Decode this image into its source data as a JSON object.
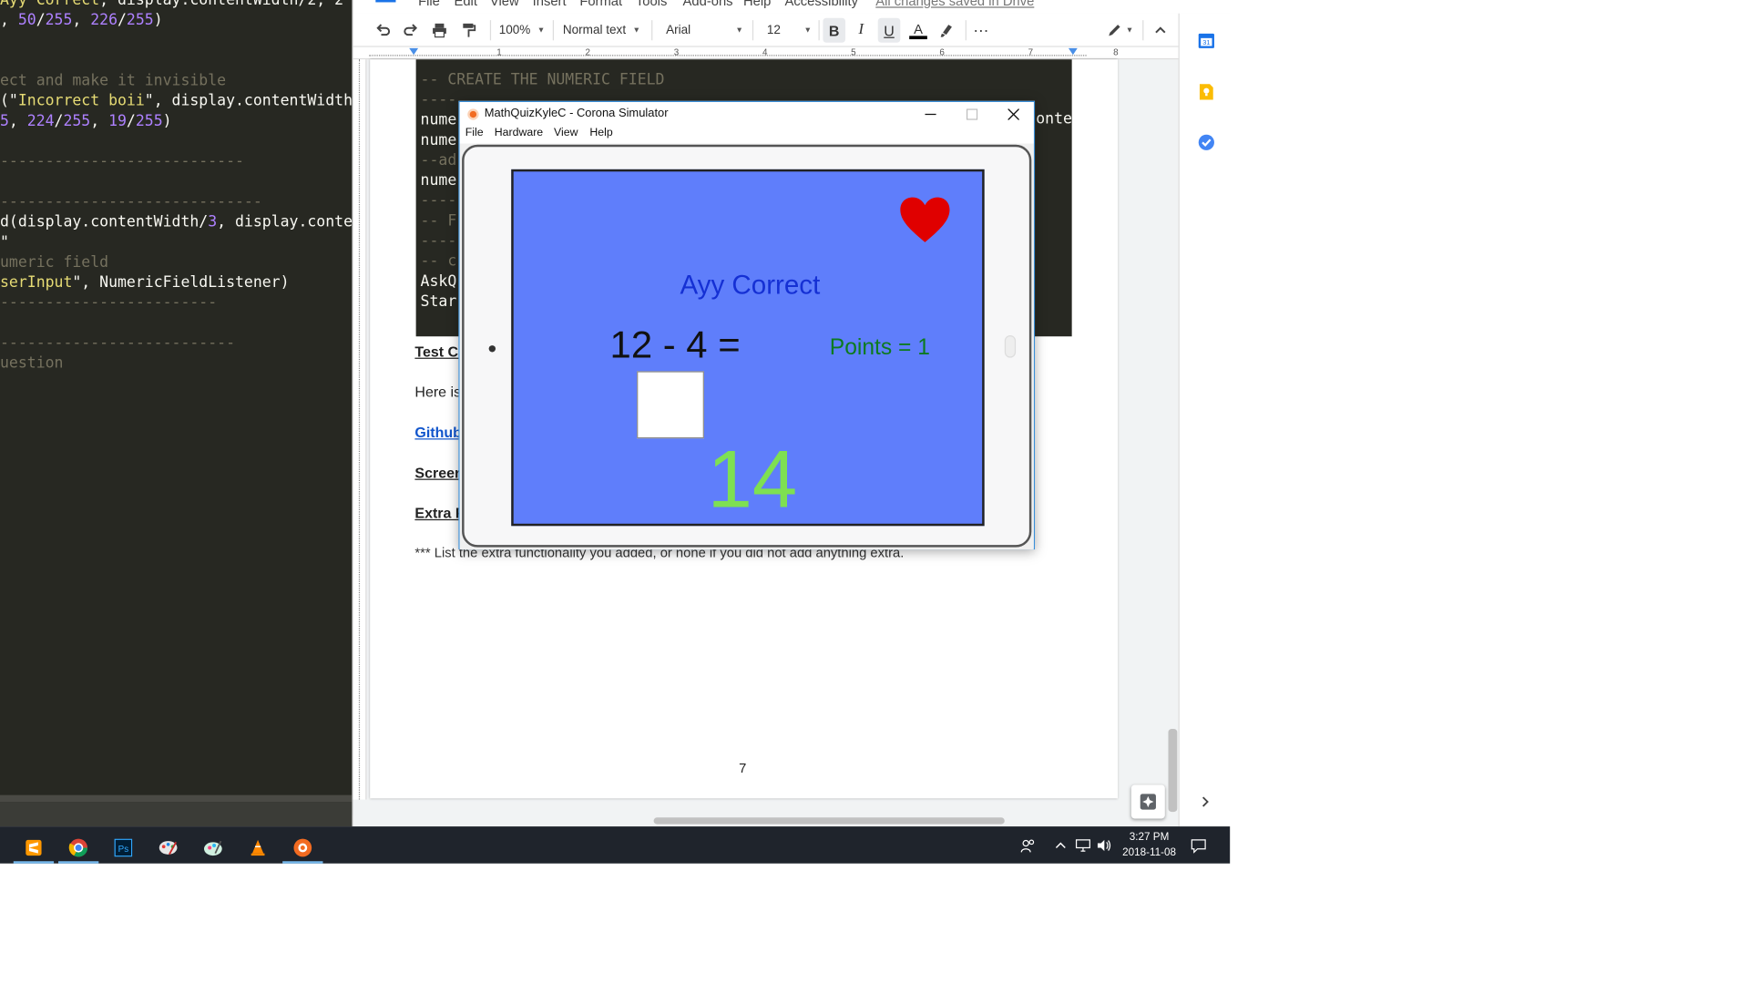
{
  "editor": {
    "lines": [
      [
        {
          "t": "Ayy Correct",
          "c": "str"
        },
        {
          "t": ", display.contentWidth/2, 2"
        }
      ],
      [
        {
          "t": ", "
        },
        {
          "t": "50",
          "c": "num"
        },
        {
          "t": "/"
        },
        {
          "t": "255",
          "c": "num"
        },
        {
          "t": ", "
        },
        {
          "t": "226",
          "c": "num"
        },
        {
          "t": "/"
        },
        {
          "t": "255",
          "c": "num"
        },
        {
          "t": ")"
        }
      ],
      [
        {
          "t": ""
        }
      ],
      [
        {
          "t": ""
        }
      ],
      [
        {
          "t": "ect and make it invisible",
          "c": "com"
        }
      ],
      [
        {
          "t": "(\""
        },
        {
          "t": "Incorrect boii",
          "c": "str"
        },
        {
          "t": "\", display.contentWidth"
        }
      ],
      [
        {
          "t": "5",
          "c": "num"
        },
        {
          "t": ", "
        },
        {
          "t": "224",
          "c": "num"
        },
        {
          "t": "/"
        },
        {
          "t": "255",
          "c": "num"
        },
        {
          "t": ", "
        },
        {
          "t": "19",
          "c": "num"
        },
        {
          "t": "/"
        },
        {
          "t": "255",
          "c": "num"
        },
        {
          "t": ")"
        }
      ],
      [
        {
          "t": ""
        }
      ],
      [
        {
          "t": "---------------------------",
          "c": "com"
        }
      ],
      [
        {
          "t": ""
        }
      ],
      [
        {
          "t": "-----------------------------",
          "c": "com"
        }
      ],
      [
        {
          "t": "d(display.contentWidth/"
        },
        {
          "t": "3",
          "c": "num"
        },
        {
          "t": ", display.conte"
        }
      ],
      [
        {
          "t": "\""
        }
      ],
      [
        {
          "t": "umeric field",
          "c": "com"
        }
      ],
      [
        {
          "t": "serInput",
          "c": "str"
        },
        {
          "t": "\", NumericFieldListener)"
        }
      ],
      [
        {
          "t": "------------------------",
          "c": "com"
        }
      ],
      [
        {
          "t": ""
        }
      ],
      [
        {
          "t": "--------------------------",
          "c": "com"
        }
      ],
      [
        {
          "t": "uestion",
          "c": "com"
        }
      ]
    ]
  },
  "docs": {
    "menu": [
      "File",
      "Edit",
      "View",
      "Insert",
      "Format",
      "Tools",
      "Add-ons",
      "Help",
      "Accessibility"
    ],
    "saved_status": "All changes saved in Drive",
    "toolbar": {
      "zoom": "100%",
      "style": "Normal text",
      "font": "Arial",
      "font_size": "12"
    },
    "ruler_numbers": [
      "1",
      "2",
      "3",
      "4",
      "5",
      "6",
      "7",
      "8"
    ],
    "code_lines": [
      [
        {
          "t": "-- CREATE THE NUMERIC FIELD",
          "c": "com"
        }
      ],
      [
        {
          "t": "----",
          "c": "com"
        }
      ],
      [
        {
          "t": "nume"
        }
      ],
      [
        {
          "t": "nume"
        }
      ],
      [
        {
          "t": "--ad",
          "c": "com"
        }
      ],
      [
        {
          "t": "nume"
        }
      ],
      [
        {
          "t": "----",
          "c": "com"
        }
      ],
      [
        {
          "t": "-- F",
          "c": "com"
        }
      ],
      [
        {
          "t": "----",
          "c": "com"
        }
      ],
      [
        {
          "t": "-- c",
          "c": "com"
        }
      ],
      [
        {
          "t": "AskQ"
        }
      ],
      [
        {
          "t": "Star"
        }
      ]
    ],
    "code_right_fragment": "onte",
    "paragraphs": {
      "test_cases": "Test Ca",
      "here_is": "Here is",
      "github": "Github",
      "screen": "Screer",
      "extra": "Extra F",
      "extra_desc": "*** List the extra functionality you added, or none if you did not add anything extra."
    },
    "page_number": "7"
  },
  "simulator": {
    "title": "MathQuizKyleC - Corona Simulator",
    "menu": [
      "File",
      "Hardware",
      "View",
      "Help"
    ],
    "app": {
      "status_text": "Ayy Correct",
      "question": "12 - 4 =",
      "points": "Points = 1",
      "big_number": "14",
      "colors": {
        "background": "#5f7efb",
        "status": "#1530d4",
        "points": "#0d7a1f",
        "big_number": "#7ee052",
        "heart": "#e00000"
      }
    }
  },
  "taskbar": {
    "apps": [
      "sublime-text-icon",
      "chrome-icon",
      "photoshop-icon",
      "paint-icon",
      "paint-3d-icon",
      "vlc-icon",
      "corona-simulator-icon"
    ],
    "time": "3:27 PM",
    "date": "2018-11-08"
  }
}
